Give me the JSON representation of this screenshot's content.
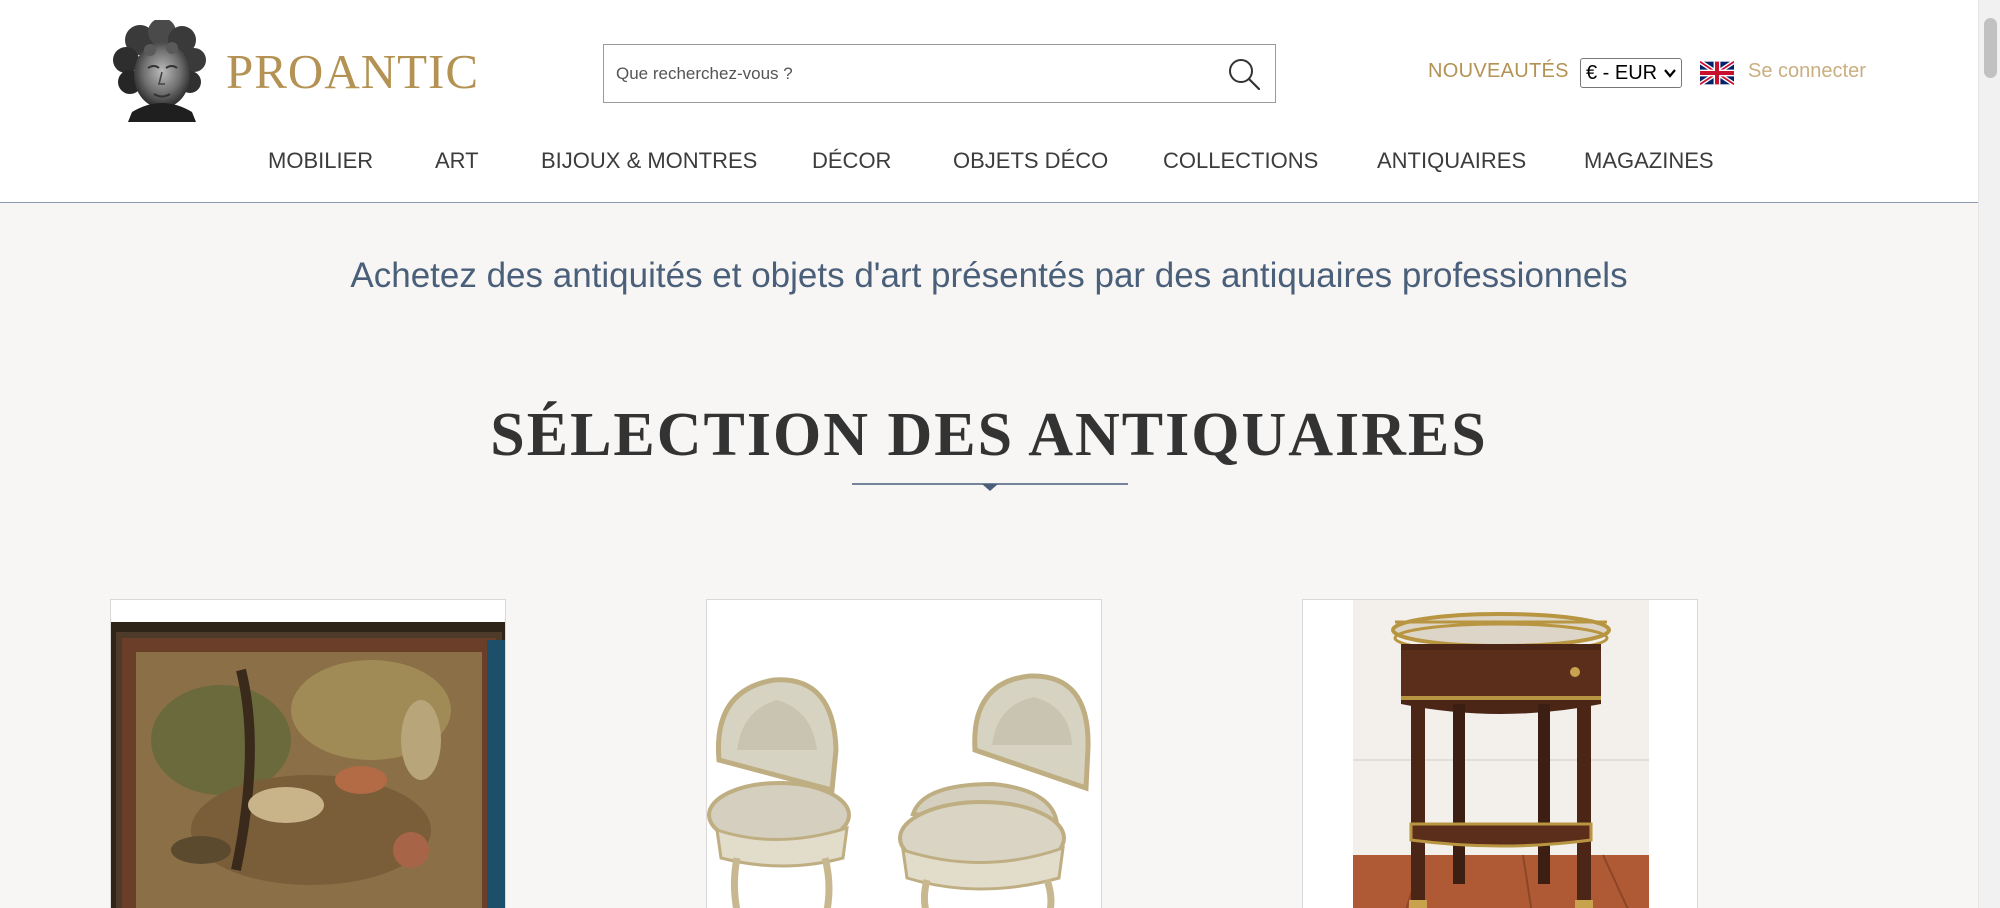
{
  "brand": {
    "name": "PROANTIC"
  },
  "search": {
    "placeholder": "Que recherchez-vous ?",
    "value": ""
  },
  "header": {
    "new_label": "NOUVEAUTÉS",
    "currency": "€ - EUR",
    "language_flag": "uk-flag-icon",
    "signin_label": "Se connecter"
  },
  "nav": {
    "items": [
      {
        "label": "MOBILIER"
      },
      {
        "label": "ART"
      },
      {
        "label": "BIJOUX & MONTRES"
      },
      {
        "label": "DÉCOR"
      },
      {
        "label": "OBJETS DÉCO"
      },
      {
        "label": "COLLECTIONS"
      },
      {
        "label": "ANTIQUAIRES"
      },
      {
        "label": "MAGAZINES"
      }
    ]
  },
  "main": {
    "tagline": "Achetez des antiquités et objets d'art présentés par des antiquaires professionnels",
    "section_title": "SÉLECTION DES ANTIQUAIRES",
    "products": [
      {
        "image": "tapestry-image"
      },
      {
        "image": "pair-of-chairs-image"
      },
      {
        "image": "side-table-image"
      }
    ]
  },
  "colors": {
    "brand_gold": "#b39253",
    "signin_gold": "#c9ae80",
    "tagline_blue": "#4a5f7a",
    "page_bg": "#f7f6f4"
  }
}
